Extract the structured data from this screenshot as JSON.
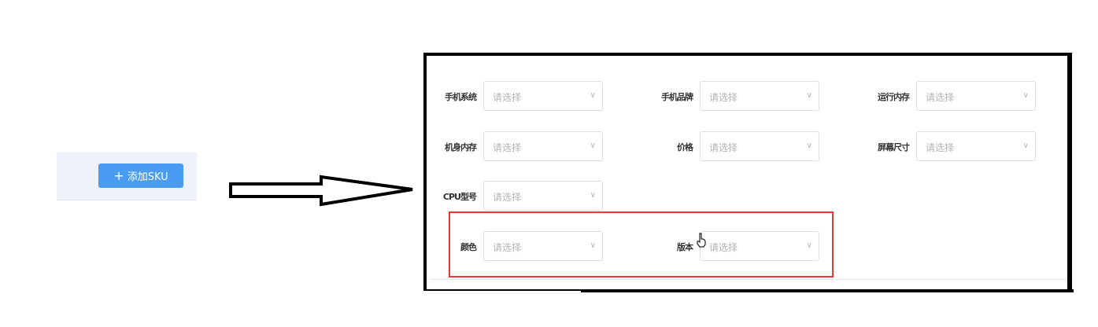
{
  "left_panel": {
    "add_sku_button": {
      "icon": "plus-icon",
      "label": "添加SKU"
    }
  },
  "form": {
    "fields": [
      {
        "label": "手机系统",
        "placeholder": "请选择"
      },
      {
        "label": "手机品牌",
        "placeholder": "请选择"
      },
      {
        "label": "运行内存",
        "placeholder": "请选择"
      },
      {
        "label": "机身内存",
        "placeholder": "请选择"
      },
      {
        "label": "价格",
        "placeholder": "请选择"
      },
      {
        "label": "屏幕尺寸",
        "placeholder": "请选择"
      },
      {
        "label": "CPU型号",
        "placeholder": "请选择"
      },
      {
        "label": "颜色",
        "placeholder": "请选择"
      },
      {
        "label": "版本",
        "placeholder": "请选择"
      }
    ]
  },
  "colors": {
    "primary_button": "#4a9bf2",
    "highlight_border": "#e53935",
    "frame_border": "#000000"
  }
}
